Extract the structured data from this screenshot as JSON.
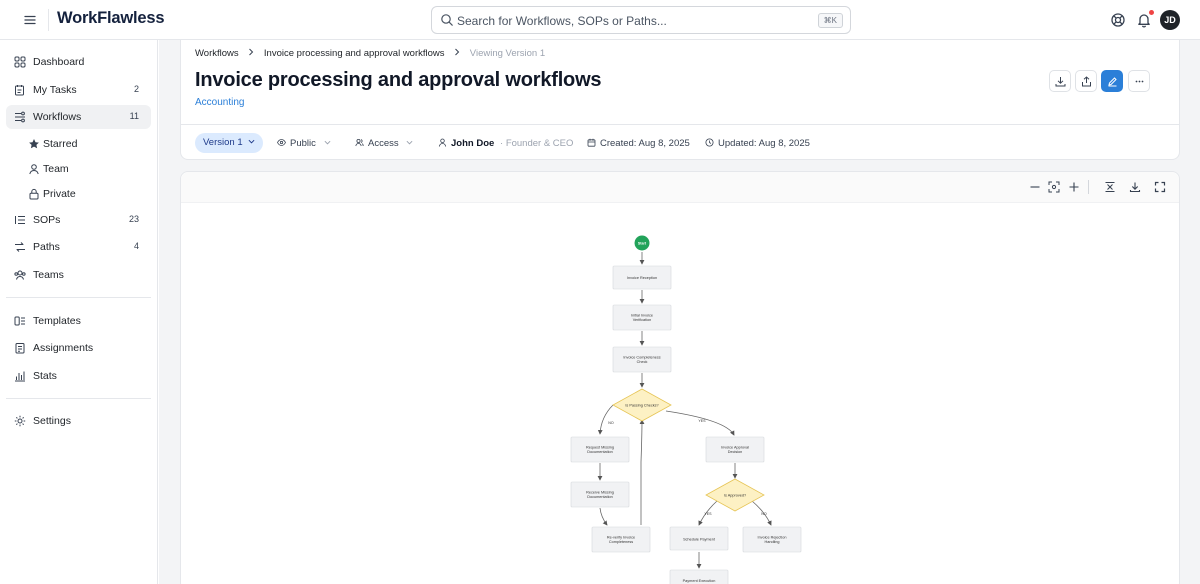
{
  "app": {
    "logo": "WorkFlawless"
  },
  "search": {
    "placeholder": "Search for Workflows, SOPs or Paths...",
    "shortcut": "⌘K"
  },
  "user": {
    "initials": "JD"
  },
  "sidebar": {
    "items": [
      {
        "label": "Dashboard",
        "icon": "dashboard-icon"
      },
      {
        "label": "My Tasks",
        "count": "2",
        "icon": "tasks-icon"
      },
      {
        "label": "Workflows",
        "count": "11",
        "icon": "workflows-icon",
        "active": true
      },
      {
        "label": "Starred",
        "icon": "star-icon"
      },
      {
        "label": "Team",
        "icon": "team-icon"
      },
      {
        "label": "Private",
        "icon": "lock-icon"
      },
      {
        "label": "SOPs",
        "count": "23",
        "icon": "list-icon"
      },
      {
        "label": "Paths",
        "count": "4",
        "icon": "paths-icon"
      },
      {
        "label": "Teams",
        "icon": "teams-icon"
      },
      {
        "label": "Templates",
        "icon": "templates-icon"
      },
      {
        "label": "Assignments",
        "icon": "assignments-icon"
      },
      {
        "label": "Stats",
        "icon": "stats-icon"
      },
      {
        "label": "Settings",
        "icon": "settings-icon"
      }
    ]
  },
  "breadcrumb": {
    "root": "Workflows",
    "current": "Invoice processing and approval workflows",
    "version": "Viewing Version 1"
  },
  "page": {
    "title": "Invoice processing and approval workflows",
    "category": "Accounting"
  },
  "meta": {
    "version": "Version 1",
    "visibility": "Public",
    "access": "Access",
    "owner_name": "John Doe",
    "owner_role": "Founder & CEO",
    "created": "Created: Aug 8, 2025",
    "updated": "Updated: Aug 8, 2025"
  },
  "flowchart": {
    "start": "Start",
    "nodes": {
      "reception": "Invoice Reception",
      "verify_1": "Initial Invoice",
      "verify_2": "Verification",
      "complete_1": "Invoice Completeness",
      "complete_2": "Check",
      "checks": "Is Passing Checks?",
      "missing_1": "Request Missing",
      "missing_2": "Documentation",
      "receive_1": "Receive Missing",
      "receive_2": "Documentation",
      "reverify_1": "Re-verify Invoice",
      "reverify_2": "Completeness",
      "approval_1": "Invoice Approval",
      "approval_2": "Decision",
      "approved": "Is Approved?",
      "schedule": "Schedule Payment",
      "rejection_1": "Invoice Rejection",
      "rejection_2": "Handling",
      "execution": "Payment Execution"
    },
    "edges": {
      "no": "NO",
      "yes": "YES"
    }
  },
  "colors": {
    "accent": "#2b7fd8",
    "start": "#22a35a",
    "decision_fill": "#fdf1c4",
    "decision_stroke": "#e6c454",
    "node_fill": "#f1f2f4"
  }
}
